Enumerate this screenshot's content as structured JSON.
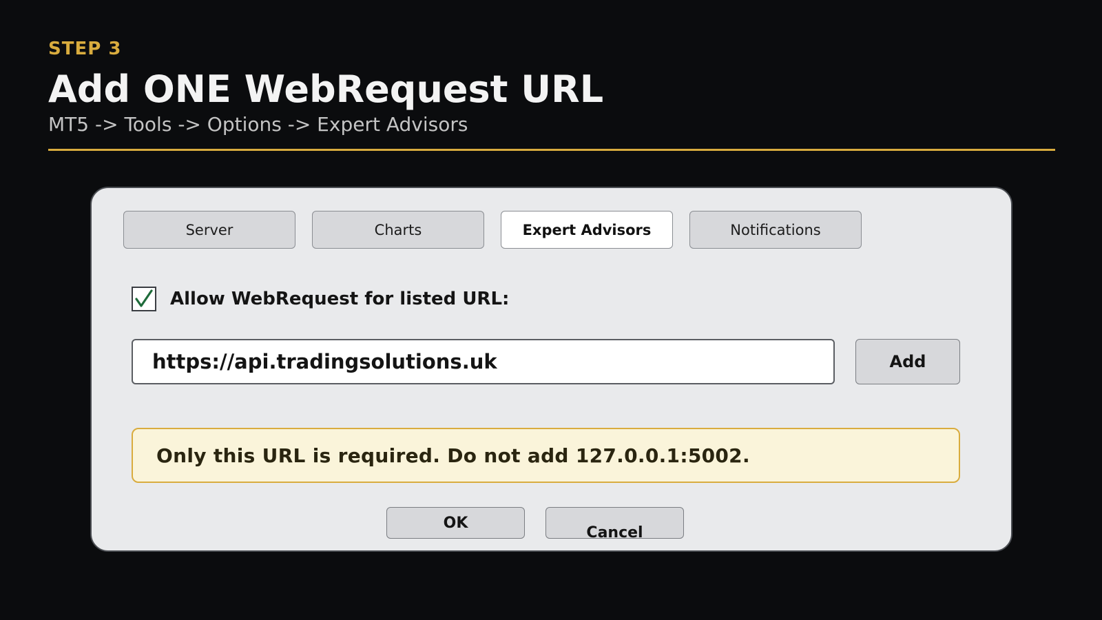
{
  "header": {
    "step": "STEP 3",
    "title": "Add ONE WebRequest URL",
    "subtitle": "MT5 -> Tools -> Options -> Expert Advisors"
  },
  "dialog": {
    "tabs": [
      {
        "label": "Server",
        "active": false
      },
      {
        "label": "Charts",
        "active": false
      },
      {
        "label": "Expert Advisors",
        "active": true
      },
      {
        "label": "Notifications",
        "active": false
      }
    ],
    "allow_webrequest": {
      "label": "Allow WebRequest for listed URL:",
      "checked": true
    },
    "url_field": {
      "value": "https://api.tradingsolutions.uk"
    },
    "add_label": "Add",
    "notice": "Only this URL is required. Do not add 127.0.0.1:5002.",
    "ok_label": "OK",
    "cancel_label": "Cancel"
  },
  "colors": {
    "accent": "#d9ac3e",
    "background": "#0b0c0e",
    "dialog_bg": "#e9eaec",
    "notice_bg": "#faf4da",
    "check_mark": "#1e6b3a"
  },
  "icons": [
    "checkmark-icon"
  ]
}
